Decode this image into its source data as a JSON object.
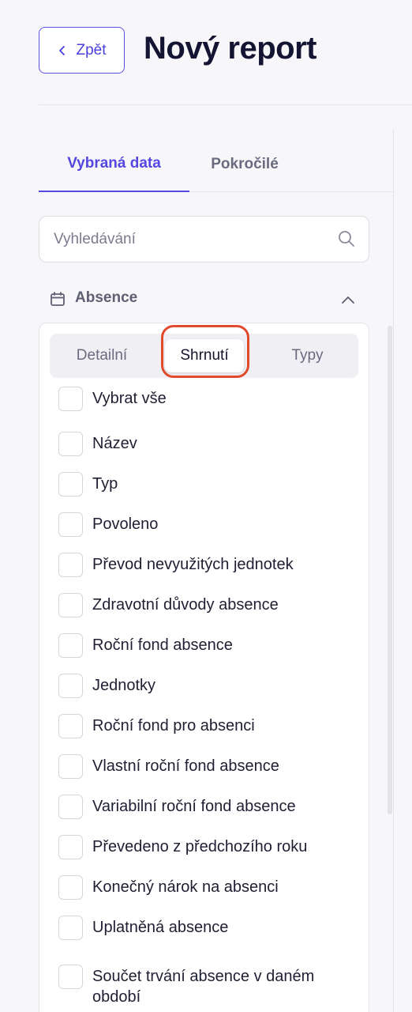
{
  "header": {
    "back_label": "Zpět",
    "title": "Nový report"
  },
  "tabs": {
    "selected_data": "Vybraná data",
    "advanced": "Pokročilé"
  },
  "search": {
    "placeholder": "Vyhledávání",
    "value": ""
  },
  "section": {
    "title": "Absence",
    "expanded": true
  },
  "view_toggle": {
    "detail": "Detailní",
    "summary": "Shrnutí",
    "types": "Typy",
    "selected": "Shrnutí"
  },
  "options": {
    "select_all": "Vybrat vše",
    "items": [
      "Název",
      "Typ",
      "Povoleno",
      "Převod nevyužitých jednotek",
      "Zdravotní důvody absence",
      "Roční fond absence",
      "Jednotky",
      "Roční fond pro absenci",
      "Vlastní roční fond absence",
      "Variabilní roční fond absence",
      "Převedeno z předchozího roku",
      "Konečný nárok na absenci",
      "Uplatněná absence",
      "Součet trvání absence v daném období"
    ]
  },
  "colors": {
    "accent": "#5548e0",
    "highlight_ring": "#e04a2d",
    "background": "#f7f7f9"
  }
}
